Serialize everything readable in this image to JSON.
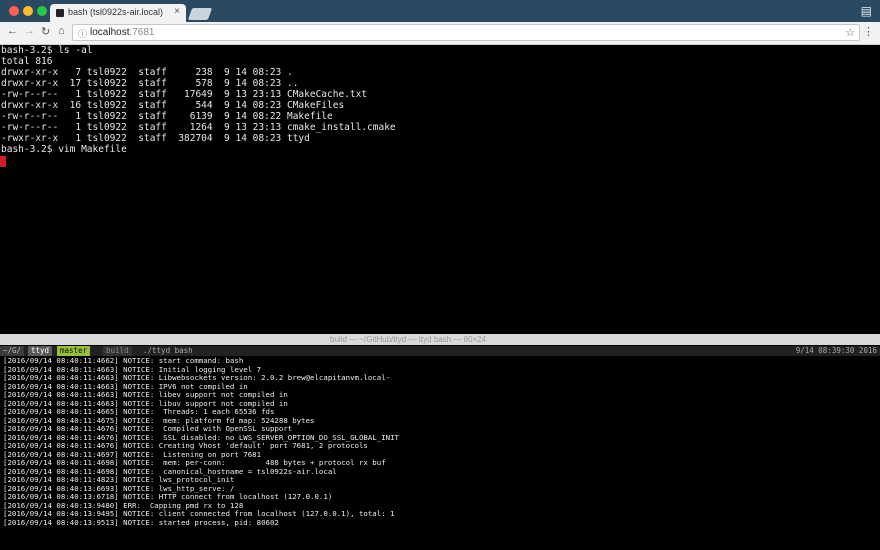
{
  "browser": {
    "tab_title": "bash (tsl0922s-air.local)",
    "url_host": "localhost",
    "url_port": ":7681"
  },
  "icons": {
    "close": "close-icon",
    "back": "back-arrow-icon",
    "forward": "forward-arrow-icon",
    "reload": "reload-icon",
    "home": "home-icon",
    "lock": "page-info-icon",
    "bookmark": "star-icon",
    "menu": "menu-icon",
    "extension": "extension-icon"
  },
  "terminal": {
    "lines": [
      "bash-3.2$ ls -al",
      "total 816",
      "drwxr-xr-x   7 tsl0922  staff     238  9 14 08:23 .",
      "drwxr-xr-x  17 tsl0922  staff     578  9 14 08:23 ..",
      "-rw-r--r--   1 tsl0922  staff   17649  9 13 23:13 CMakeCache.txt",
      "drwxr-xr-x  16 tsl0922  staff     544  9 14 08:23 CMakeFiles",
      "-rw-r--r--   1 tsl0922  staff    6139  9 14 08:22 Makefile",
      "-rw-r--r--   1 tsl0922  staff    1264  9 13 23:13 cmake_install.cmake",
      "-rwxr-xr-x   1 tsl0922  staff  382704  9 14 08:23 ttyd",
      "bash-3.2$ vim Makefile"
    ],
    "cursor_color": "#d11a2a"
  },
  "tmux": {
    "window_title": "build — ~/GitHub/ttyd — ttyd bash — 80×24",
    "status": {
      "path": "~/G/",
      "name": "ttyd",
      "branch": "master",
      "build": "build",
      "command": "./ttyd bash",
      "time": "9/14 08:39:30 2016"
    },
    "log_lines": [
      "[2016/09/14 08:40:11:4662] NOTICE: start command: bash",
      "[2016/09/14 08:40:11:4663] NOTICE: Initial logging level 7",
      "[2016/09/14 08:40:11:4663] NOTICE: Libwebsockets version: 2.0.2 brew@elcapitanvm.local-",
      "[2016/09/14 08:40:11:4663] NOTICE: IPV6 not compiled in",
      "[2016/09/14 08:40:11:4663] NOTICE: libev support not compiled in",
      "[2016/09/14 08:40:11:4663] NOTICE: libuv support not compiled in",
      "[2016/09/14 08:40:11:4665] NOTICE:  Threads: 1 each 65536 fds",
      "[2016/09/14 08:40:11:4675] NOTICE:  mem: platform fd map: 524288 bytes",
      "[2016/09/14 08:40:11:4676] NOTICE:  Compiled with OpenSSL support",
      "[2016/09/14 08:40:11:4676] NOTICE:  SSL disabled: no LWS_SERVER_OPTION_DO_SSL_GLOBAL_INIT",
      "[2016/09/14 08:40:11:4676] NOTICE: Creating Vhost 'default' port 7681, 2 protocols",
      "[2016/09/14 08:40:11:4697] NOTICE:  Listening on port 7681",
      "[2016/09/14 08:40:11:4698] NOTICE:  mem: per-conn:         488 bytes + protocol rx buf",
      "[2016/09/14 08:40:11:4698] NOTICE:  canonical_hostname = tsl0922s-air.local",
      "[2016/09/14 08:40:11:4823] NOTICE: lws_protocol_init",
      "[2016/09/14 08:40:13:6693] NOTICE: lws_http_serve: /",
      "[2016/09/14 08:40:13:6718] NOTICE: HTTP connect from localhost (127.0.0.1)",
      "[2016/09/14 08:40:13:9480] ERR:  Capping pmd rx to 128",
      "[2016/09/14 08:40:13:9495] NOTICE: client connected from localhost (127.0.0.1), total: 1",
      "[2016/09/14 08:40:13:9513] NOTICE: started process, pid: 80602"
    ]
  }
}
